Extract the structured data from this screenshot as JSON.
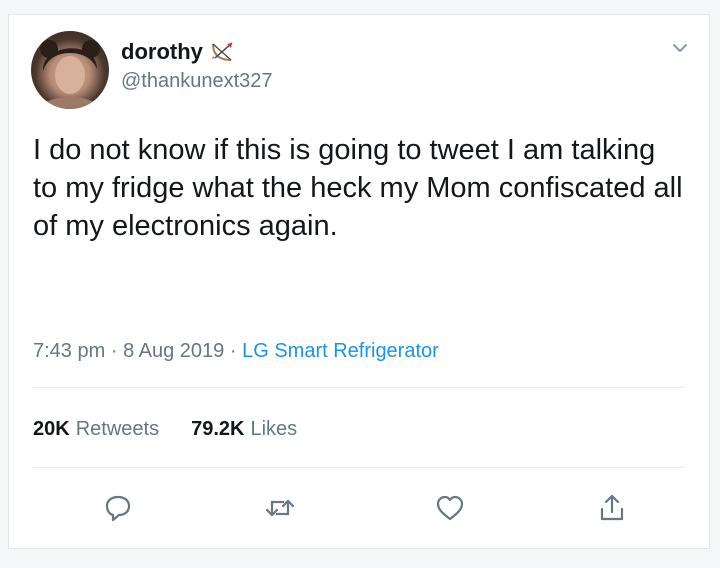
{
  "user": {
    "name": "dorothy",
    "handle": "@thankunext327"
  },
  "tweet": {
    "text": "I do not know if this is going to tweet I am talking to my fridge what the heck my Mom confiscated all of my electronics again.",
    "time": "7:43 pm",
    "date": "8 Aug 2019",
    "separator": "·",
    "source": "LG Smart Refrigerator"
  },
  "stats": {
    "retweets_count": "20K",
    "retweets_label": "Retweets",
    "likes_count": "79.2K",
    "likes_label": "Likes"
  },
  "icons": {
    "name_emoji": "bow-and-arrow-icon",
    "menu": "chevron-down-icon",
    "reply": "reply-icon",
    "retweet": "retweet-icon",
    "like": "heart-icon",
    "share": "share-icon"
  },
  "colors": {
    "text": "#14171a",
    "secondary": "#657786",
    "link": "#1b95e0",
    "icon": "#657786"
  }
}
